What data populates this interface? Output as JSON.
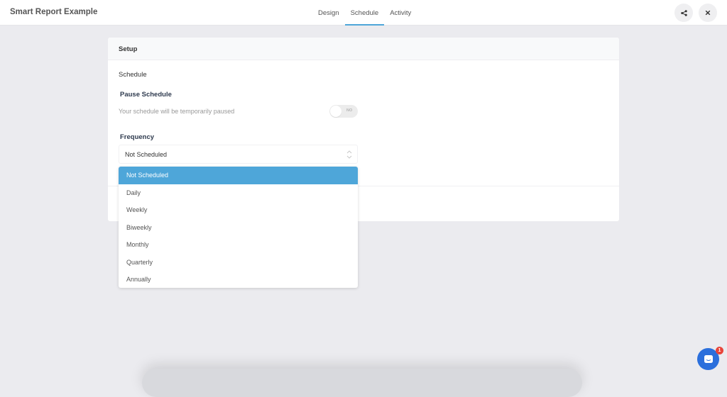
{
  "header": {
    "app_title": "Smart Report Example",
    "tabs": [
      {
        "label": "Design",
        "active": false
      },
      {
        "label": "Schedule",
        "active": true
      },
      {
        "label": "Activity",
        "active": false
      }
    ],
    "actions": [
      {
        "icon": "share-icon"
      },
      {
        "icon": "close-icon"
      }
    ]
  },
  "panel": {
    "header": "Setup",
    "section_title": "Schedule",
    "pause": {
      "label": "Pause Schedule",
      "help": "Your schedule will be temporarily paused",
      "toggle_text": "NO",
      "enabled": false
    },
    "frequency": {
      "label": "Frequency",
      "value": "Not Scheduled",
      "options": [
        "Not Scheduled",
        "Daily",
        "Weekly",
        "Biweekly",
        "Monthly",
        "Quarterly",
        "Annually"
      ],
      "selected_index": 0
    }
  },
  "chat": {
    "icon": "chat-icon",
    "badge": "1"
  },
  "colors": {
    "accent": "#4ea6d9",
    "chat": "#2b6fdc",
    "badge": "#e8443a"
  }
}
